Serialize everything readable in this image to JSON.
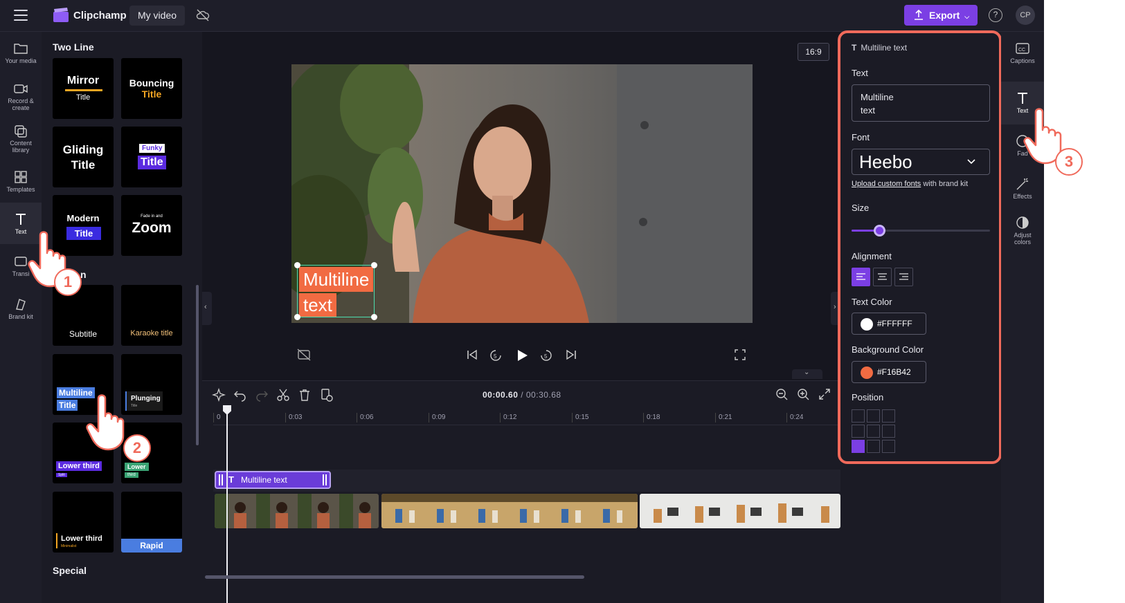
{
  "topbar": {
    "app_name": "Clipchamp",
    "project_name": "My video",
    "export_label": "Export",
    "help": "?",
    "avatar_initials": "CP"
  },
  "left_rail": [
    {
      "label": "Your media"
    },
    {
      "label": "Record & create"
    },
    {
      "label": "Content library"
    },
    {
      "label": "Templates"
    },
    {
      "label": "Text"
    },
    {
      "label": "Transi"
    },
    {
      "label": "Brand kit"
    }
  ],
  "text_panel": {
    "section_two_line": "Two Line",
    "section_partial": "n",
    "section_special": "Special",
    "tiles": {
      "mirror": [
        "Mirror",
        "Title"
      ],
      "bouncing": [
        "Bouncing",
        "Title"
      ],
      "gliding": [
        "Gliding",
        "Title"
      ],
      "funky": [
        "Funky",
        "Title"
      ],
      "modern": [
        "Modern",
        "Title"
      ],
      "zoom": [
        "Fade in and",
        "Zoom"
      ],
      "subtitle": "Subtitle",
      "karaoke": "Karaoke title",
      "multiline": [
        "Multiline",
        "Title"
      ],
      "plunging": [
        "Plunging",
        "Title"
      ],
      "lower_third_split": [
        "Lower third",
        "Split"
      ],
      "lower_third_small": [
        "Lower",
        "third"
      ],
      "lower_third_minimalist": [
        "Lower third",
        "Minimalist"
      ],
      "rapid": "Rapid"
    }
  },
  "preview": {
    "aspect_ratio": "16:9",
    "overlay_line1": "Multiline",
    "overlay_line2": "text"
  },
  "timeline": {
    "current": "00:00.60",
    "total": "/ 00:30.68",
    "ticks": [
      "0",
      "0:03",
      "0:06",
      "0:09",
      "0:12",
      "0:15",
      "0:18",
      "0:21",
      "0:24"
    ],
    "text_clip": "Multiline text"
  },
  "properties": {
    "header": "Multiline text",
    "text_label": "Text",
    "text_value_l1": "Multiline",
    "text_value_l2": "text",
    "font_label": "Font",
    "font_value": "Heebo",
    "upload_link": "Upload custom fonts",
    "upload_suffix": "with brand kit",
    "size_label": "Size",
    "size_fraction": 0.2,
    "alignment_label": "Alignment",
    "text_color_label": "Text Color",
    "text_color": "#FFFFFF",
    "bg_color_label": "Background Color",
    "bg_color": "#F16B42",
    "position_label": "Position"
  },
  "right_rail": [
    {
      "label": "Captions"
    },
    {
      "label": "Text"
    },
    {
      "label": "Fad"
    },
    {
      "label": "Effects"
    },
    {
      "label": "Adjust colors"
    }
  ],
  "steps": [
    "1",
    "2",
    "3"
  ],
  "colors": {
    "accent": "#7B3FE4",
    "highlight": "#F06A5B"
  }
}
